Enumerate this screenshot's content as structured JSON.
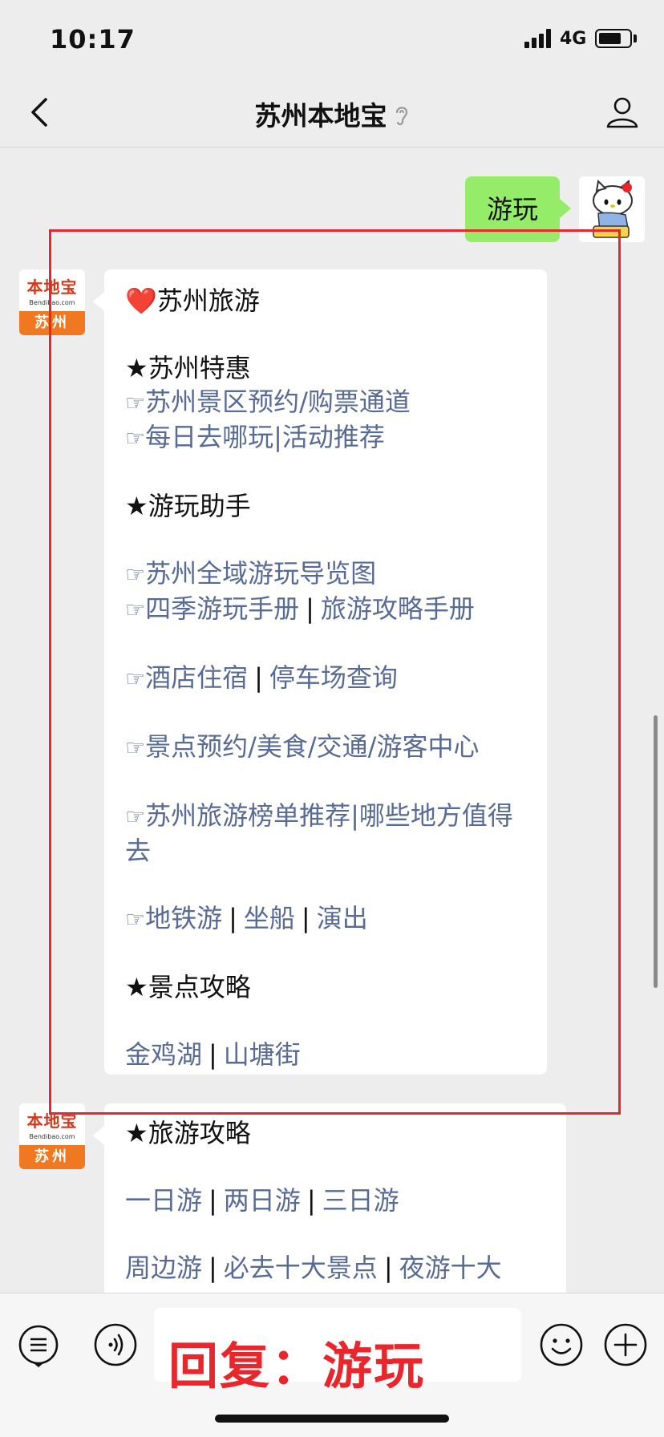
{
  "status_bar": {
    "time": "10:17",
    "network": "4G",
    "battery_level": 0.75
  },
  "nav": {
    "title": "苏州本地宝",
    "back_icon": "chevron-left-icon",
    "title_icon": "ear-icon",
    "profile_icon": "person-icon"
  },
  "user_message": {
    "text": "游玩",
    "bubble_color": "#95ec69"
  },
  "bot_avatar": {
    "brand_cn": "本地宝",
    "brand_en": "Bendibao.com",
    "city": "苏州",
    "brand_color": "#f07820"
  },
  "message1": {
    "title": "❤️苏州旅游",
    "section1": "★苏州特惠",
    "s1_links": [
      "苏州景区预约/购票通道",
      "每日去哪玩|活动推荐"
    ],
    "section2": "★游玩助手",
    "s2_link1": "苏州全域游玩导览图",
    "s2_link2a": "四季游玩手册",
    "s2_link2b": "旅游攻略手册",
    "s2_link3a": "酒店住宿",
    "s2_link3b": "停车场查询",
    "s2_link4": "景点预约/美食/交通/游客中心",
    "s2_link5": "苏州旅游榜单推荐|哪些地方值得去",
    "s2_link6a": "地铁游",
    "s2_link6b": "坐船",
    "s2_link6c": "演出",
    "section3": "★景点攻略",
    "s3_link_a": "金鸡湖",
    "s3_link_b": "山塘街",
    "hand_glyph": "☞",
    "separator": "|"
  },
  "message2": {
    "section": "★旅游攻略",
    "link_a": "一日游",
    "link_b": "两日游",
    "link_c": "三日游",
    "link_d": "周边游",
    "link_e": "必去十大景点",
    "link_f": "夜游十大"
  },
  "input_bar": {
    "overlay": "回复：游玩",
    "menu_icon": "list-menu-icon",
    "voice_icon": "voice-icon",
    "emoji_icon": "emoji-icon",
    "add_icon": "plus-icon"
  },
  "colors": {
    "link": "#576b95",
    "highlight": "#e8262b"
  }
}
